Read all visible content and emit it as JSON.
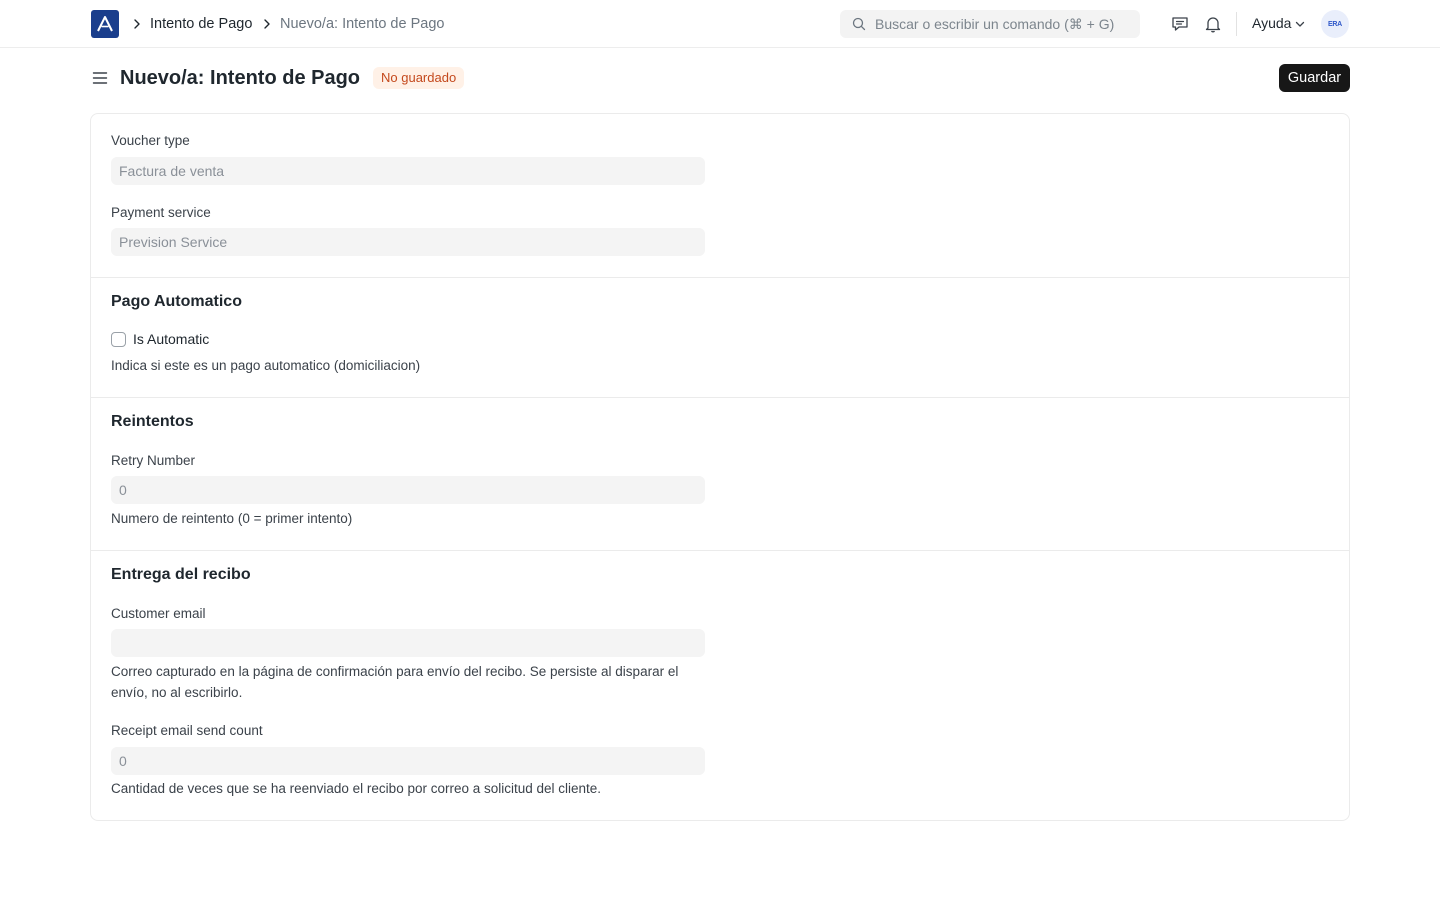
{
  "navbar": {
    "breadcrumbs": [
      "Intento de Pago",
      "Nuevo/a: Intento de Pago"
    ],
    "search_placeholder": "Buscar o escribir un comando (⌘ + G)",
    "help_label": "Ayuda",
    "avatar_text": "ERA"
  },
  "page": {
    "title": "Nuevo/a: Intento de Pago",
    "status_badge": "No guardado",
    "save_label": "Guardar"
  },
  "form": {
    "voucher_type": {
      "label": "Voucher type",
      "placeholder": "Factura de venta"
    },
    "payment_service": {
      "label": "Payment service",
      "placeholder": "Prevision Service"
    },
    "section_automatic": {
      "title": "Pago Automatico",
      "checkbox_label": "Is Automatic",
      "checked": false,
      "description": "Indica si este es un pago automatico (domiciliacion)"
    },
    "section_retries": {
      "title": "Reintentos",
      "retry_number": {
        "label": "Retry Number",
        "placeholder": "0"
      },
      "description": "Numero de reintento (0 = primer intento)"
    },
    "section_receipt": {
      "title": "Entrega del recibo",
      "customer_email": {
        "label": "Customer email",
        "placeholder": "",
        "description": "Correo capturado en la página de confirmación para envío del recibo. Se persiste al disparar el envío, no al escribirlo."
      },
      "send_count": {
        "label": "Receipt email send count",
        "placeholder": "0",
        "description": "Cantidad de veces que se ha reenviado el recibo por correo a solicitud del cliente."
      }
    }
  },
  "colors": {
    "logo_bg": "#1a3e8c",
    "save_button_bg": "#171717",
    "badge_bg": "#fff1e7",
    "badge_text": "#c4491d"
  }
}
